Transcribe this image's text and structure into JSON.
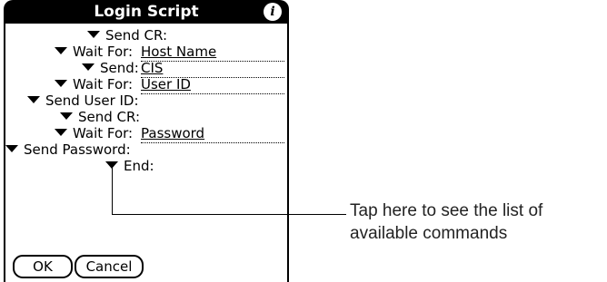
{
  "window": {
    "title": "Login Script",
    "info_icon": "info-icon"
  },
  "script_lines": [
    {
      "command": "Send CR:"
    },
    {
      "command": "Wait For:",
      "value": "Host Name"
    },
    {
      "command": "Send:",
      "value": "CIS"
    },
    {
      "command": "Wait For:",
      "value": "User ID"
    },
    {
      "command": "Send User ID:"
    },
    {
      "command": "Send CR:"
    },
    {
      "command": "Wait For:",
      "value": "Password"
    },
    {
      "command": "Send Password:"
    },
    {
      "command": "End:"
    }
  ],
  "buttons": {
    "ok": "OK",
    "cancel": "Cancel"
  },
  "callout": {
    "line1": "Tap here to see the list of",
    "line2": "available commands"
  }
}
